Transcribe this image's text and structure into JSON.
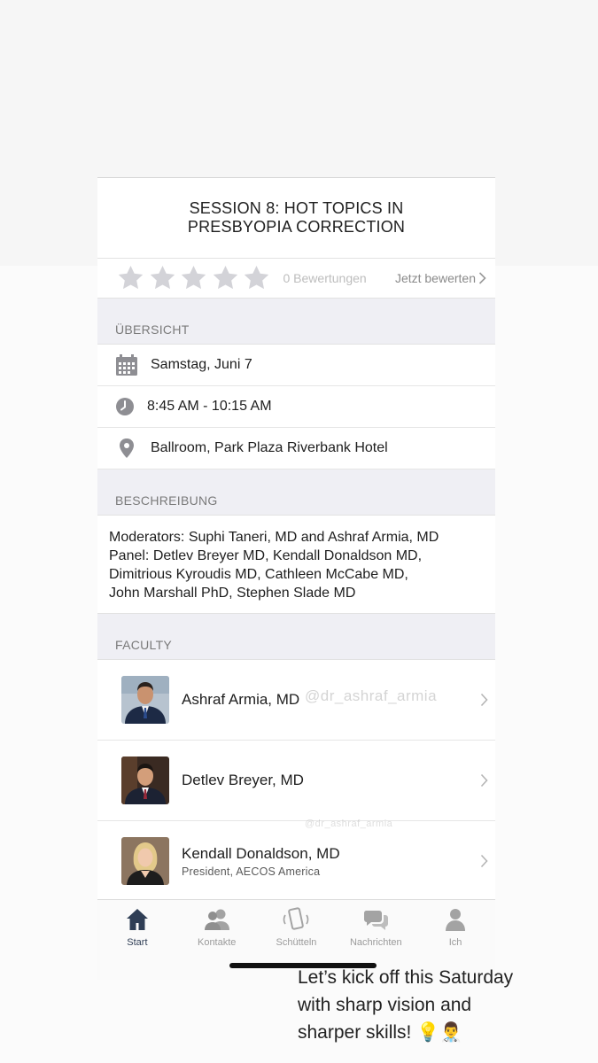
{
  "session": {
    "title_line1": "SESSION 8: HOT TOPICS IN",
    "title_line2": "PRESBYOPIA CORRECTION"
  },
  "rating": {
    "stars": 5,
    "filled": 0,
    "count_label": "0 Bewertungen",
    "rate_label": "Jetzt bewerten"
  },
  "overview": {
    "header": "ÜBERSICHT",
    "date": "Samstag, Juni 7",
    "time": "8:45 AM - 10:15 AM",
    "location": "Ballroom, Park Plaza Riverbank Hotel"
  },
  "description": {
    "header": "BESCHREIBUNG",
    "lines": [
      "Moderators: Suphi Taneri, MD and Ashraf Armia, MD",
      "Panel: Detlev Breyer MD, Kendall Donaldson MD,",
      "Dimitrious Kyroudis MD, Cathleen McCabe MD,",
      "John Marshall PhD, Stephen Slade MD"
    ]
  },
  "faculty": {
    "header": "FACULTY",
    "items": [
      {
        "name": "Ashraf Armia, MD",
        "subtitle": ""
      },
      {
        "name": "Detlev Breyer, MD",
        "subtitle": ""
      },
      {
        "name": "Kendall Donaldson, MD",
        "subtitle": "President, AECOS America"
      }
    ]
  },
  "tabbar": {
    "tabs": [
      {
        "label": "Start",
        "icon": "home-icon",
        "active": true
      },
      {
        "label": "Kontakte",
        "icon": "contacts-icon",
        "active": false
      },
      {
        "label": "Schütteln",
        "icon": "shake-phone-icon",
        "active": false
      },
      {
        "label": "Nachrichten",
        "icon": "messages-icon",
        "active": false
      },
      {
        "label": "Ich",
        "icon": "profile-icon",
        "active": false
      }
    ]
  },
  "overlay": {
    "caption_lines": [
      "Let’s kick off this Saturday",
      "with sharp vision and",
      "sharper skills! 💡👨‍⚕️"
    ],
    "watermark": "@dr_ashraf_armia",
    "watermark_small": "@dr_ashraf_armia"
  },
  "colors": {
    "accent": "#2f3e55",
    "star": "#d3d3d8",
    "section_bg": "#efeff4"
  }
}
